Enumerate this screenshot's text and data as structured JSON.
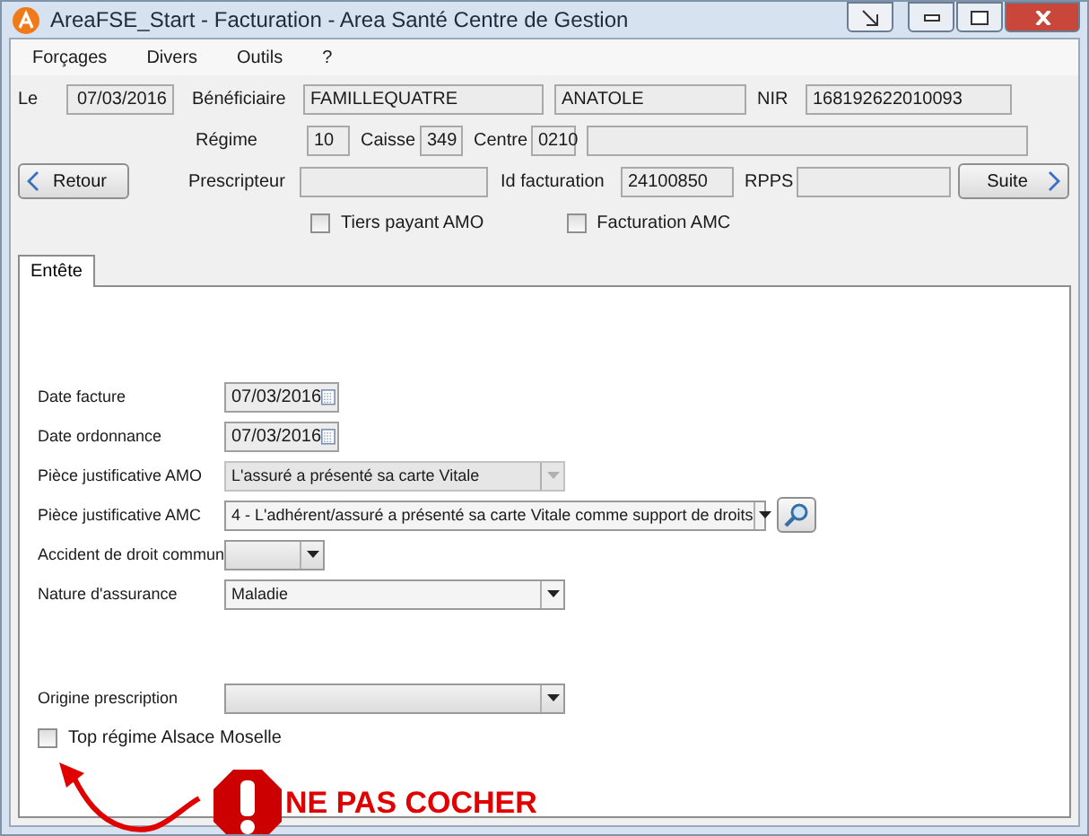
{
  "window": {
    "title": "AreaFSE_Start - Facturation - Area Santé Centre de Gestion"
  },
  "menu": [
    "Forçages",
    "Divers",
    "Outils",
    "?"
  ],
  "header": {
    "le": {
      "label": "Le",
      "value": "07/03/2016"
    },
    "beneficiaire": {
      "label": "Bénéficiaire",
      "nom": "FAMILLEQUATRE",
      "prenom": "ANATOLE"
    },
    "nir": {
      "label": "NIR",
      "value": "168192622010093"
    },
    "regime": {
      "label": "Régime",
      "value": "10"
    },
    "caisse": {
      "label": "Caisse",
      "value": "349"
    },
    "centre": {
      "label": "Centre",
      "value": "0210"
    },
    "prescripteur": {
      "label": "Prescripteur"
    },
    "id_facturation": {
      "label": "Id facturation",
      "value": "24100850"
    },
    "rpps": {
      "label": "RPPS"
    },
    "back_button": "Retour",
    "next_button": "Suite",
    "checkboxes": [
      {
        "label": "Tiers payant AMO",
        "checked": false
      },
      {
        "label": "Facturation AMC",
        "checked": false
      }
    ]
  },
  "tabs": [
    {
      "label": "Entête",
      "selected": true
    }
  ],
  "form": {
    "rows": [
      {
        "kind": "date",
        "label": "Date facture",
        "value": "07/03/2016"
      },
      {
        "kind": "date",
        "label": "Date ordonnance",
        "value": "07/03/2016"
      },
      {
        "kind": "select",
        "label": "Pièce justificative AMO",
        "value": "L'assuré a présenté sa carte Vitale",
        "disabled": true
      },
      {
        "kind": "lookup",
        "label": "Pièce justificative AMC",
        "value": "4 - L'adhérent/assuré a présenté sa carte Vitale comme support de droits",
        "disabled": false
      },
      {
        "kind": "select",
        "label": "Accident de droit commun",
        "disabled": false
      },
      {
        "kind": "select",
        "label": "Nature d'assurance",
        "value": "Maladie",
        "disabled": false
      }
    ],
    "lower_rows": [
      {
        "kind": "select",
        "label": "Origine prescription",
        "disabled": false
      },
      {
        "kind": "checkbox",
        "label": "Top régime Alsace Moselle",
        "checked": false
      }
    ]
  },
  "annotation": {
    "text": "NE PAS COCHER"
  }
}
